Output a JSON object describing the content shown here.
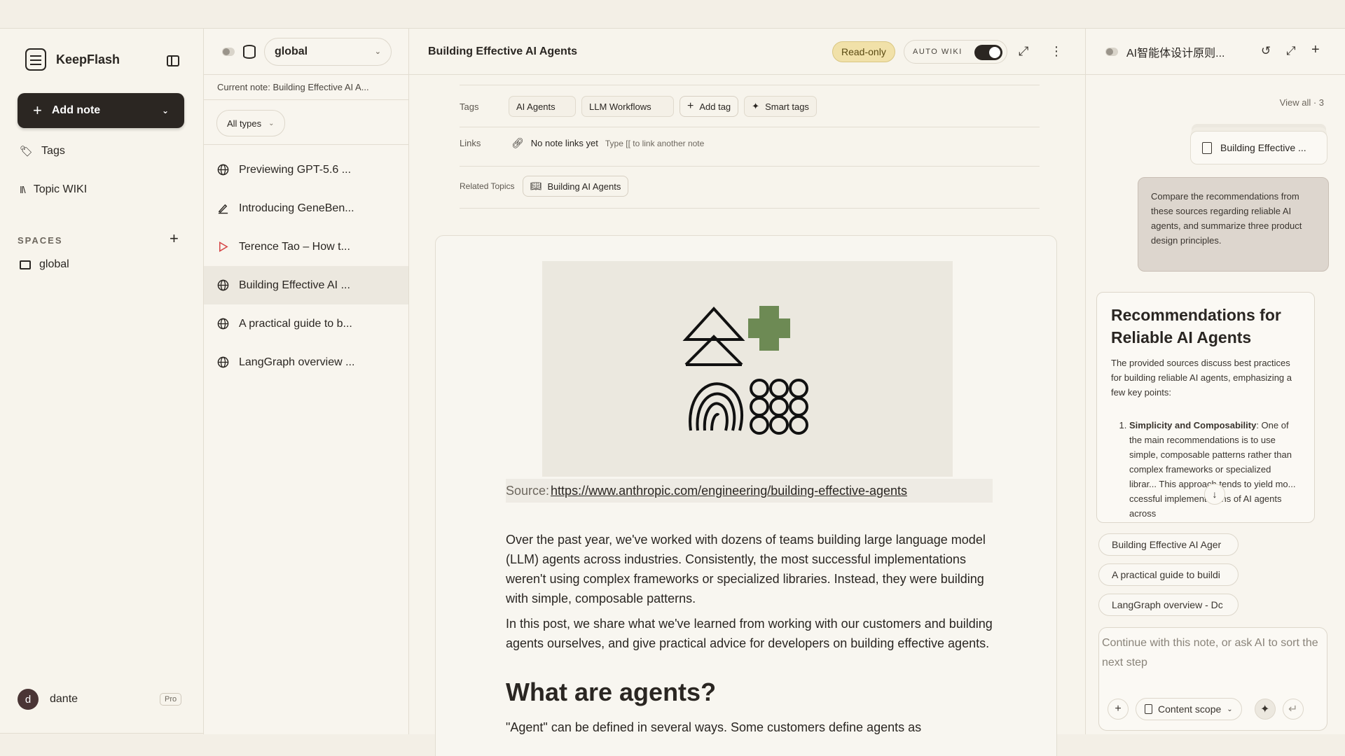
{
  "app": {
    "name": "KeepFlash"
  },
  "sidebar": {
    "add_note_label": "Add note",
    "items": [
      {
        "label": "Tags"
      },
      {
        "label": "Topic WIKI"
      }
    ],
    "spaces_label": "SPACES",
    "spaces": [
      {
        "label": "global"
      }
    ],
    "user": {
      "name": "dante",
      "initial": "d",
      "plan": "Pro"
    }
  },
  "notes_panel": {
    "space": "global",
    "current_note": "Current note: Building Effective AI A...",
    "filter": "All types",
    "notes": [
      {
        "title": "Previewing GPT-5.6 ...",
        "icon": "globe-icon"
      },
      {
        "title": "Introducing GeneBen...",
        "icon": "pen-icon"
      },
      {
        "title": "Terence Tao – How t...",
        "icon": "play-icon"
      },
      {
        "title": "Building Effective AI ...",
        "icon": "globe-icon",
        "active": true
      },
      {
        "title": "A practical guide to b...",
        "icon": "globe-icon"
      },
      {
        "title": "LangGraph overview ...",
        "icon": "globe-icon"
      }
    ]
  },
  "main": {
    "title": "Building Effective AI Agents",
    "readonly_label": "Read-only",
    "autowiki_label": "AUTO WIKI",
    "tags_label": "Tags",
    "tags": [
      "AI Agents",
      "LLM Workflows"
    ],
    "add_tag": "Add tag",
    "smart_tags": "Smart tags",
    "links_label": "Links",
    "links_empty": "No note links yet",
    "links_hint": "Type [[ to link another note",
    "related_label": "Related Topics",
    "related_topic": "Building AI Agents",
    "source_prefix": "Source:",
    "source_url": "https://www.anthropic.com/engineering/building-effective-agents",
    "para1": "Over the past year, we've worked with dozens of teams building large language model (LLM) agents across industries. Consistently, the most successful implementations weren't using complex frameworks or specialized libraries. Instead, they were building with simple, composable patterns.",
    "para2": "In this post, we share what we've learned from working with our customers and building agents ourselves, and give practical advice for developers on building effective agents.",
    "heading": "What are agents?",
    "para3": "\"Agent\" can be defined in several ways. Some customers define agents as"
  },
  "ai_panel": {
    "title": "AI智能体设计原则...",
    "view_all": "View all · 3",
    "source_card": "Building Effective ...",
    "user_message": "Compare the recommendations from these sources regarding reliable AI agents, and summarize three product design principles.",
    "answer_title": "Recommendations for Reliable AI Agents",
    "answer_intro": "The provided sources discuss best practices for building reliable AI agents, emphasizing a few key points:",
    "answer_item1_bold": "Simplicity and Composability",
    "answer_item1_text": ": One of the main recommendations is to use simple, composable patterns rather than complex frameworks or specialized librar... This approach tends to yield mo... ccessful implementations of AI agents across",
    "refs": [
      "Building Effective AI Ager",
      "A practical guide to buildi",
      "LangGraph overview - Dc"
    ],
    "composer_placeholder": "Continue with this note, or ask AI to sort the next step",
    "scope_label": "Content scope"
  }
}
